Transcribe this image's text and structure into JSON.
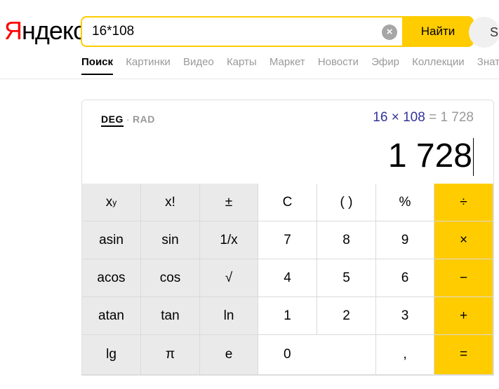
{
  "logo": {
    "first": "Я",
    "rest": "ндекс"
  },
  "search": {
    "query": "16*108",
    "clear_icon": "×",
    "button": "Найти"
  },
  "avatar_initial": "S",
  "tabs": [
    {
      "label": "Поиск",
      "active": true
    },
    {
      "label": "Картинки"
    },
    {
      "label": "Видео"
    },
    {
      "label": "Карты"
    },
    {
      "label": "Маркет"
    },
    {
      "label": "Новости"
    },
    {
      "label": "Эфир"
    },
    {
      "label": "Коллекции"
    },
    {
      "label": "Знат"
    }
  ],
  "calculator": {
    "mode_deg": "DEG",
    "mode_sep": "·",
    "mode_rad": "RAD",
    "expression": "16 × 108",
    "equals": "= 1 728",
    "result": "1 728",
    "keys": {
      "pow_base": "x",
      "pow_exp": "y",
      "fact": "x!",
      "plusminus": "±",
      "clear": "C",
      "parens": "( )",
      "percent": "%",
      "divide": "÷",
      "asin": "asin",
      "sin": "sin",
      "recip": "1/x",
      "k7": "7",
      "k8": "8",
      "k9": "9",
      "multiply": "×",
      "acos": "acos",
      "cos": "cos",
      "sqrt": "√",
      "k4": "4",
      "k5": "5",
      "k6": "6",
      "minus": "−",
      "atan": "atan",
      "tan": "tan",
      "ln": "ln",
      "k1": "1",
      "k2": "2",
      "k3": "3",
      "plus": "+",
      "lg": "lg",
      "pi": "π",
      "e": "e",
      "k0": "0",
      "comma": ",",
      "equals": "="
    }
  },
  "colors": {
    "accent": "#ffcc00",
    "logo_red": "#ff0000",
    "expression": "#33339a"
  }
}
